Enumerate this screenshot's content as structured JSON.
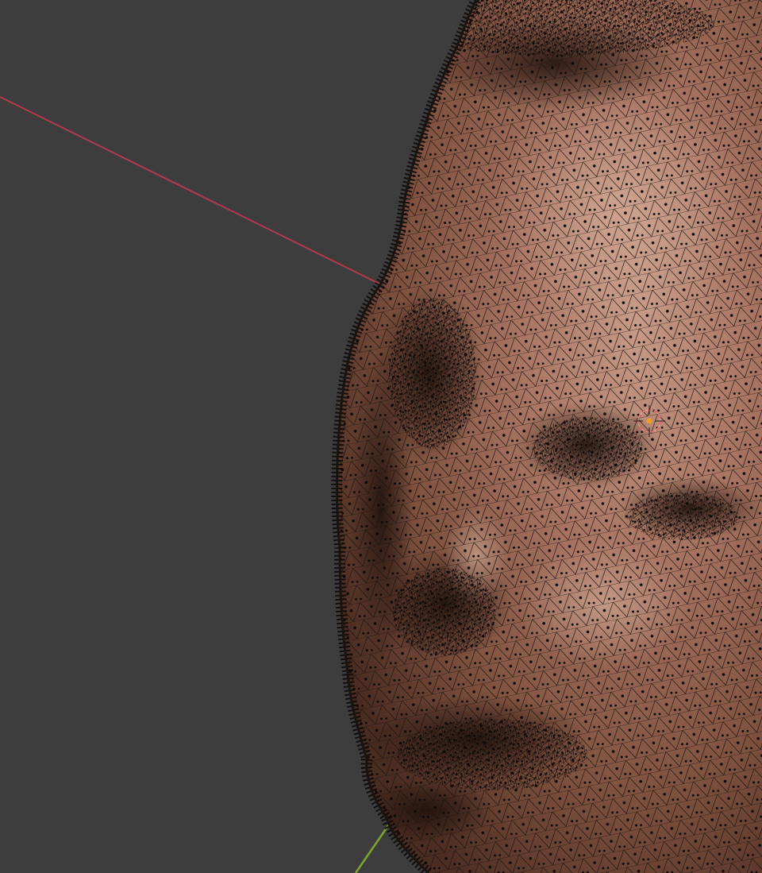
{
  "app": {
    "type": "3d-viewport",
    "view": "mesh-edit-wireframe-overlay"
  },
  "viewport": {
    "background": "#3d3d3d",
    "x_axis_color": "#b23a4e",
    "y_axis_color": "#7fa42a",
    "mesh_edge_color": "#1a1410",
    "vertex_color": "#0d0908",
    "skin_light": "#b98a76",
    "skin_mid": "#8e5f4b",
    "skin_dark": "#3a2218"
  },
  "object": {
    "name_icon": "head-mesh-icon",
    "mode": "edit"
  },
  "cursor_3d": {
    "icon": "3d-cursor-icon",
    "ring_color": "#d94040",
    "center_color": "#f0a020"
  }
}
